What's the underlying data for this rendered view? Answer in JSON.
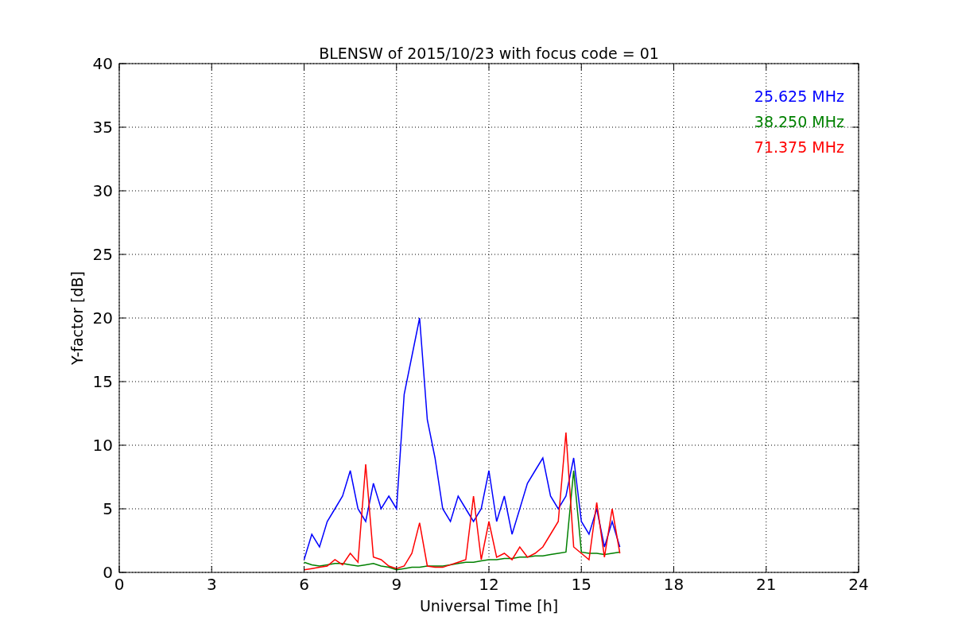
{
  "figure": {
    "chart_data": {
      "type": "line",
      "title": "BLENSW of 2015/10/23 with focus code = 01",
      "xlabel": "Universal Time [h]",
      "ylabel": "Y-factor [dB]",
      "x": [
        6,
        6.25,
        6.5,
        6.75,
        7,
        7.25,
        7.5,
        7.75,
        8,
        8.25,
        8.5,
        8.75,
        9,
        9.25,
        9.5,
        9.75,
        10,
        10.25,
        10.5,
        10.75,
        11,
        11.25,
        11.5,
        11.75,
        12,
        12.25,
        12.5,
        12.75,
        13,
        13.25,
        13.5,
        13.75,
        14,
        14.25,
        14.5,
        14.75,
        15,
        15.25,
        15.5,
        15.75,
        16,
        16.25
      ],
      "series": [
        {
          "name": "25.625 MHz",
          "color": "#0000ff",
          "values": [
            1,
            3,
            2,
            4,
            5,
            6,
            8,
            5,
            4,
            7,
            5,
            6,
            5,
            14,
            17,
            20,
            12,
            9,
            5,
            4,
            6,
            5,
            4,
            5,
            8,
            4,
            6,
            3,
            5,
            7,
            8,
            9,
            6,
            5,
            6,
            9,
            4,
            3,
            5,
            2,
            4,
            2
          ]
        },
        {
          "name": "38.250 MHz",
          "color": "#008000",
          "values": [
            0.8,
            0.6,
            0.5,
            0.6,
            0.7,
            0.7,
            0.6,
            0.5,
            0.6,
            0.7,
            0.5,
            0.4,
            0.2,
            0.3,
            0.4,
            0.4,
            0.5,
            0.5,
            0.5,
            0.6,
            0.7,
            0.8,
            0.8,
            0.9,
            1,
            1,
            1.1,
            1.1,
            1.2,
            1.2,
            1.3,
            1.3,
            1.4,
            1.5,
            1.6,
            8,
            1.6,
            1.5,
            1.5,
            1.4,
            1.5,
            1.6
          ]
        },
        {
          "name": "71.375 MHz",
          "color": "#ff0000",
          "values": [
            0.2,
            0.3,
            0.4,
            0.5,
            1,
            0.6,
            1.5,
            0.8,
            8.5,
            1.2,
            1,
            0.5,
            0.3,
            0.5,
            1.5,
            3.9,
            0.5,
            0.4,
            0.4,
            0.6,
            0.8,
            1,
            6,
            1,
            4,
            1.2,
            1.5,
            1,
            2,
            1.2,
            1.5,
            2,
            3,
            4,
            11,
            2,
            1.5,
            1,
            5.5,
            1.2,
            5,
            1.5
          ]
        }
      ],
      "grid": true,
      "xlim": [
        0,
        24
      ],
      "ylim": [
        0,
        40
      ],
      "xticks": [
        0,
        3,
        6,
        9,
        12,
        15,
        18,
        21,
        24
      ],
      "yticks": [
        0,
        5,
        10,
        15,
        20,
        25,
        30,
        35,
        40
      ]
    }
  }
}
